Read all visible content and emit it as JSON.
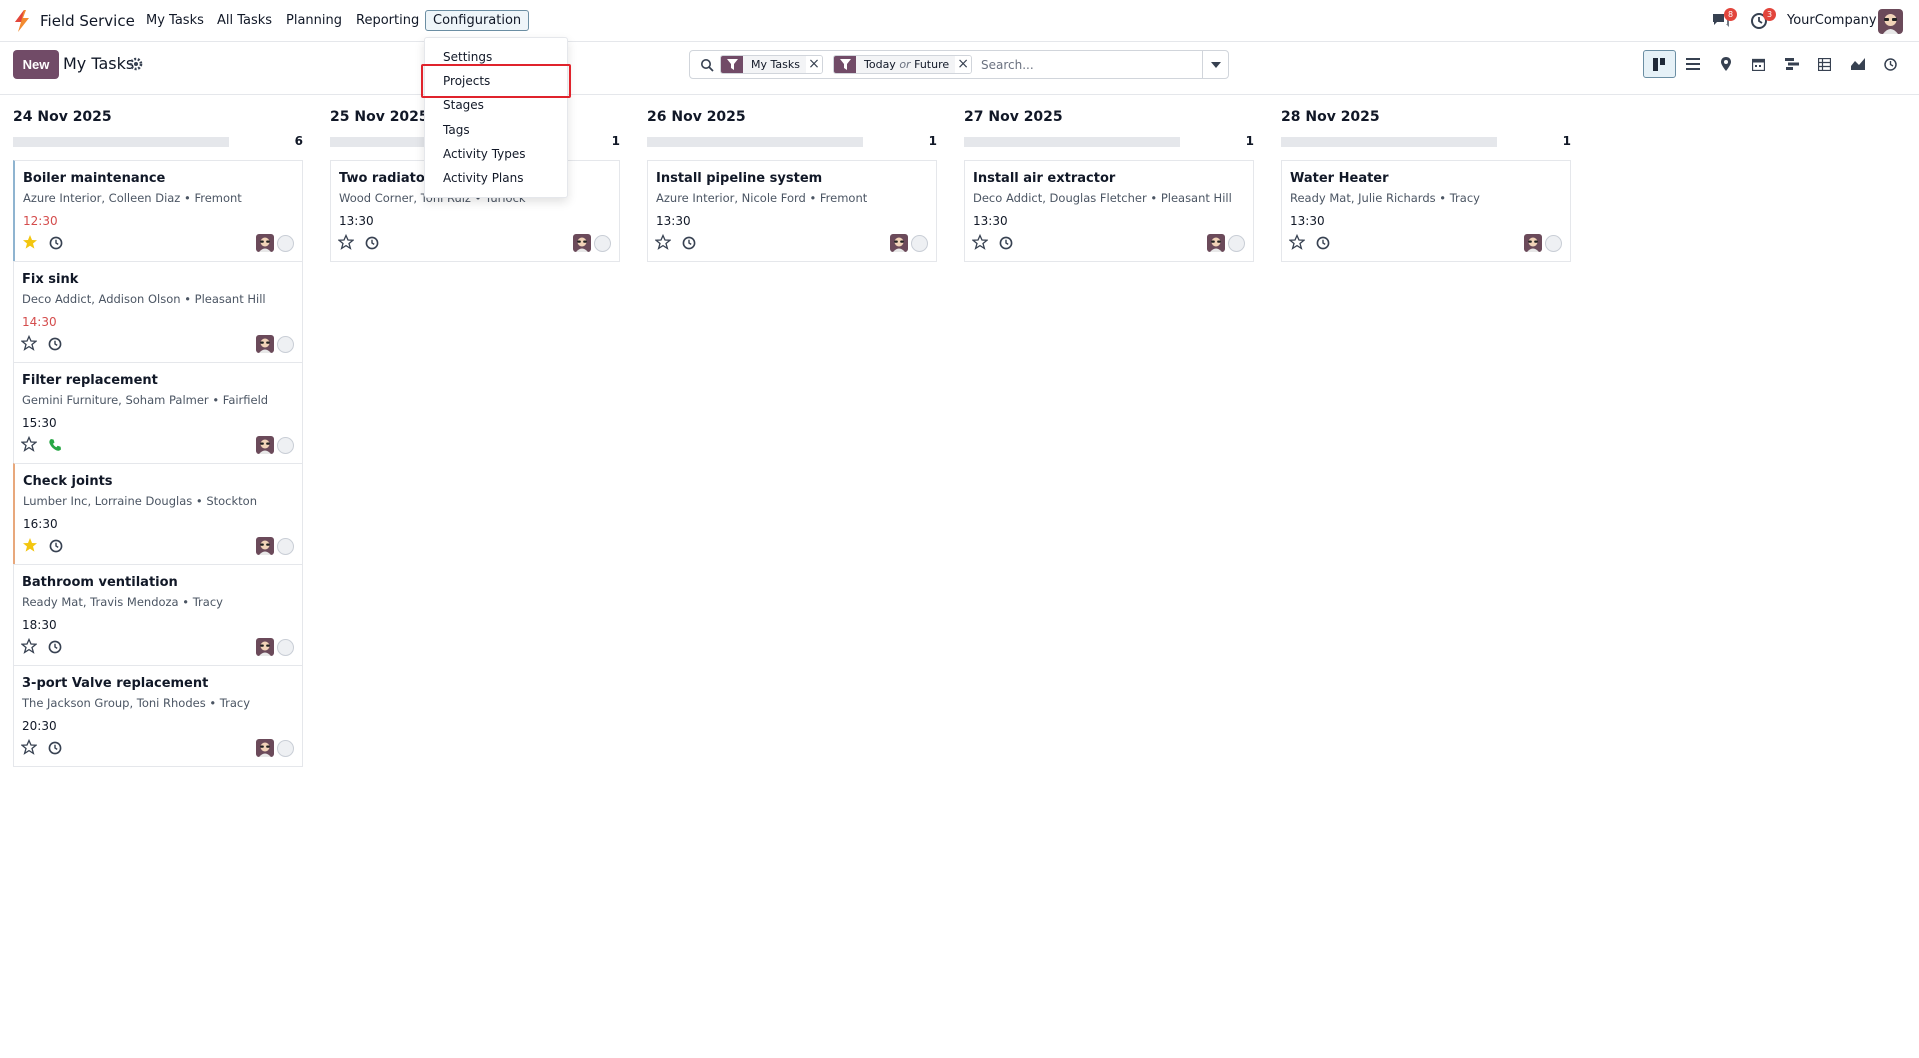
{
  "app": {
    "name": "Field Service"
  },
  "menu": [
    {
      "label": "My Tasks"
    },
    {
      "label": "All Tasks"
    },
    {
      "label": "Planning"
    },
    {
      "label": "Reporting"
    },
    {
      "label": "Configuration"
    }
  ],
  "topbar": {
    "messages_badge": "8",
    "activities_badge": "3",
    "company": "YourCompany"
  },
  "control": {
    "new_label": "New",
    "title": "My Tasks"
  },
  "search": {
    "facet1": "My Tasks",
    "facet2_a": "Today",
    "facet2_or": "or",
    "facet2_b": "Future",
    "placeholder": "Search..."
  },
  "views": [
    "kanban-icon",
    "list-icon",
    "map-icon",
    "calendar-icon",
    "gantt-icon",
    "pivot-icon",
    "graph-icon",
    "activity-icon"
  ],
  "dropdown": {
    "items": [
      "Settings",
      "Projects",
      "Stages",
      "Tags",
      "Activity Types",
      "Activity Plans"
    ],
    "highlighted": "Projects"
  },
  "columns": [
    {
      "title": "24 Nov 2025",
      "count": "6",
      "cards": [
        {
          "title": "Boiler maintenance",
          "sub": "Azure Interior, Colleen Diaz • Fremont",
          "time": "12:30",
          "late": true,
          "starred": true,
          "activity": "clock-icon"
        },
        {
          "title": "Fix sink",
          "sub": "Deco Addict, Addison Olson • Pleasant Hill",
          "time": "14:30",
          "late": true,
          "starred": false,
          "activity": "clock-icon"
        },
        {
          "title": "Filter replacement",
          "sub": "Gemini Furniture, Soham Palmer • Fairfield",
          "time": "15:30",
          "late": false,
          "starred": false,
          "activity": "phone-icon"
        },
        {
          "title": "Check joints",
          "sub": "Lumber Inc, Lorraine Douglas • Stockton",
          "time": "16:30",
          "late": false,
          "starred": true,
          "activity": "clock-icon"
        },
        {
          "title": "Bathroom ventilation",
          "sub": "Ready Mat, Travis Mendoza • Tracy",
          "time": "18:30",
          "late": false,
          "starred": false,
          "activity": "clock-icon"
        },
        {
          "title": "3-port Valve replacement",
          "sub": "The Jackson Group, Toni Rhodes • Tracy",
          "time": "20:30",
          "late": false,
          "starred": false,
          "activity": "clock-icon"
        }
      ]
    },
    {
      "title": "25 Nov 2025",
      "count": "1",
      "cards": [
        {
          "title": "Two radiators",
          "sub": "Wood Corner, Toni Ruiz • Turlock",
          "time": "13:30",
          "late": false,
          "starred": false,
          "activity": "clock-icon"
        }
      ]
    },
    {
      "title": "26 Nov 2025",
      "count": "1",
      "cards": [
        {
          "title": "Install pipeline system",
          "sub": "Azure Interior, Nicole Ford • Fremont",
          "time": "13:30",
          "late": false,
          "starred": false,
          "activity": "clock-icon"
        }
      ]
    },
    {
      "title": "27 Nov 2025",
      "count": "1",
      "cards": [
        {
          "title": "Install air extractor",
          "sub": "Deco Addict, Douglas Fletcher • Pleasant Hill",
          "time": "13:30",
          "late": false,
          "starred": false,
          "activity": "clock-icon"
        }
      ]
    },
    {
      "title": "28 Nov 2025",
      "count": "1",
      "cards": [
        {
          "title": "Water Heater",
          "sub": "Ready Mat, Julie Richards • Tracy",
          "time": "13:30",
          "late": false,
          "starred": false,
          "activity": "clock-icon"
        }
      ]
    }
  ],
  "colors": {
    "primary": "#714b67",
    "late": "#d44c4c",
    "star": "#f3c60f",
    "highlight": "#e0232c"
  }
}
